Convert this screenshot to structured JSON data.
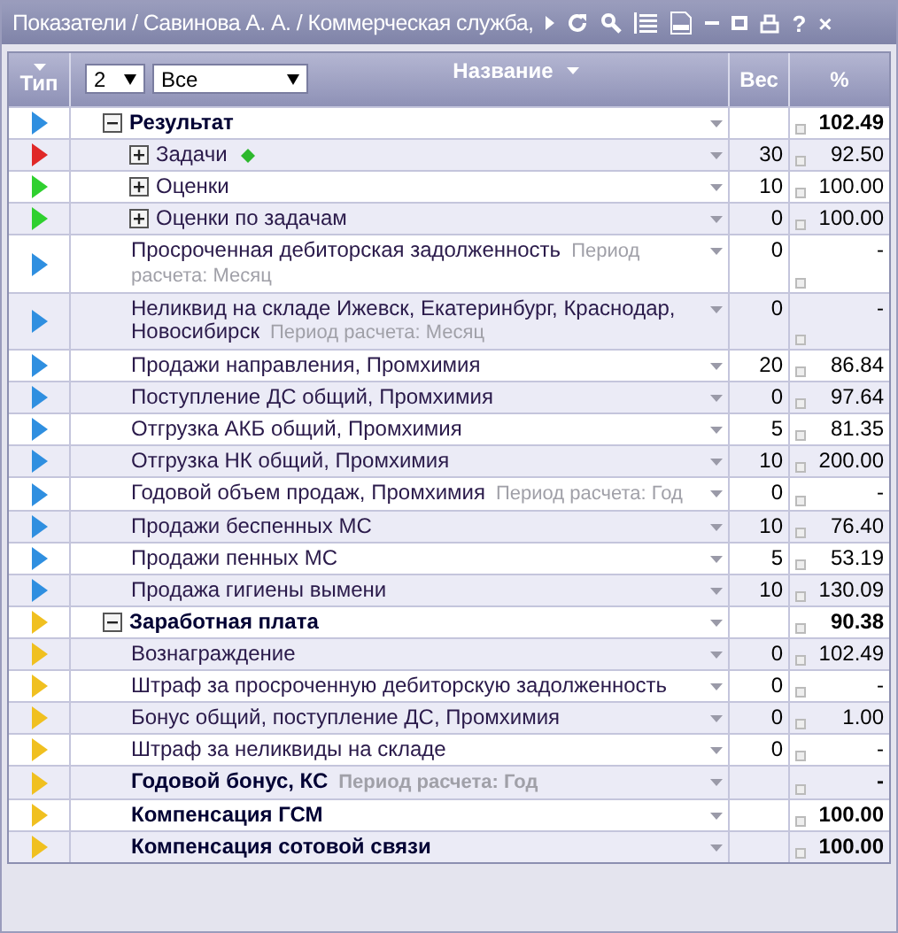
{
  "window": {
    "title": "Показатели / Савинова А. А. / Коммерческая служба,",
    "text_buttons": [
      "?",
      "×"
    ]
  },
  "header": {
    "type_column": "Тип",
    "name_column": "Название",
    "weight_column": "Вес",
    "percent_column": "%",
    "level_filter": "2",
    "status_filter": "Все"
  },
  "rows": [
    {
      "name": "Результат",
      "bold": true,
      "color": "#2f8fe0",
      "expanded": true,
      "percent": "102.49",
      "children": [
        {
          "name": "Задачи",
          "bold": false,
          "color": "#e02828",
          "expanded": false,
          "flagged": true,
          "weight": "30",
          "percent": "92.50"
        },
        {
          "name": "Оценки",
          "bold": false,
          "color": "#2fd02f",
          "expanded": false,
          "weight": "10",
          "percent": "100.00"
        },
        {
          "name": "Оценки по задачам",
          "bold": false,
          "color": "#2fd02f",
          "expanded": false,
          "weight": "0",
          "percent": "100.00"
        },
        {
          "name": "Просроченная дебиторская задолженность",
          "note": "Период расчета: Месяц",
          "bold": false,
          "color": "#2f8fe0",
          "weight": "0",
          "percent": "-"
        },
        {
          "name": "Неликвид на складе Ижевск, Екатеринбург, Краснодар, Новосибирск",
          "note": "Период расчета: Месяц",
          "bold": false,
          "color": "#2f8fe0",
          "weight": "0",
          "percent": "-"
        },
        {
          "name": "Продажи направления, Промхимия",
          "bold": false,
          "color": "#2f8fe0",
          "weight": "20",
          "percent": "86.84"
        },
        {
          "name": "Поступление ДС общий, Промхимия",
          "bold": false,
          "color": "#2f8fe0",
          "weight": "0",
          "percent": "97.64"
        },
        {
          "name": "Отгрузка АКБ общий, Промхимия",
          "bold": false,
          "color": "#2f8fe0",
          "weight": "5",
          "percent": "81.35"
        },
        {
          "name": "Отгрузка НК общий, Промхимия",
          "bold": false,
          "color": "#2f8fe0",
          "weight": "10",
          "percent": "200.00"
        },
        {
          "name": "Годовой объем продаж, Промхимия",
          "note": "Период расчета: Год",
          "bold": false,
          "color": "#2f8fe0",
          "weight": "0",
          "percent": "-"
        },
        {
          "name": "Продажи беспенных МС",
          "bold": false,
          "color": "#2f8fe0",
          "weight": "10",
          "percent": "76.40"
        },
        {
          "name": "Продажи пенных МС",
          "bold": false,
          "color": "#2f8fe0",
          "weight": "5",
          "percent": "53.19"
        },
        {
          "name": "Продажа гигиены вымени",
          "bold": false,
          "color": "#2f8fe0",
          "weight": "10",
          "percent": "130.09"
        }
      ]
    },
    {
      "name": "Заработная плата",
      "bold": true,
      "color": "#f0c020",
      "expanded": true,
      "percent": "90.38",
      "children": [
        {
          "name": "Вознаграждение",
          "bold": false,
          "color": "#f0c020",
          "weight": "0",
          "percent": "102.49"
        },
        {
          "name": "Штраф за просроченную дебиторскую задолженность",
          "bold": false,
          "color": "#f0c020",
          "weight": "0",
          "percent": "-"
        },
        {
          "name": "Бонус общий, поступление ДС, Промхимия",
          "bold": false,
          "color": "#f0c020",
          "weight": "0",
          "percent": "1.00"
        },
        {
          "name": "Штраф за неликвиды на складе",
          "bold": false,
          "color": "#f0c020",
          "weight": "0",
          "percent": "-"
        },
        {
          "name": "Годовой бонус, КС",
          "note": "Период расчета: Год",
          "bold": true,
          "color": "#f0c020",
          "percent": "-"
        },
        {
          "name": "Компенсация ГСМ",
          "bold": true,
          "color": "#f0c020",
          "percent": "100.00"
        },
        {
          "name": "Компенсация сотовой связи",
          "bold": true,
          "color": "#f0c020",
          "percent": "100.00"
        }
      ]
    }
  ]
}
